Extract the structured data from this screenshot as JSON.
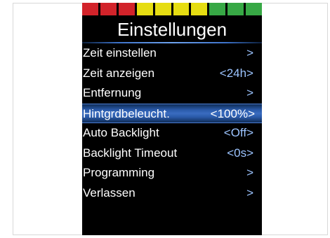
{
  "colors": {
    "bar_red": "#d2232a",
    "bar_yellow": "#e6dd12",
    "bar_green": "#37a845",
    "screen_bg": "#000000",
    "selection": "#3a6cc0",
    "value_text": "#9cc4ff"
  },
  "level_bar": {
    "segments": [
      "red",
      "red",
      "red",
      "yellow",
      "yellow",
      "yellow",
      "yellow",
      "green",
      "green",
      "green"
    ]
  },
  "title": "Einstellungen",
  "menu": {
    "items": [
      {
        "label": "Zeit einstellen",
        "value": ">"
      },
      {
        "label": "Zeit anzeigen",
        "value": "<24h>"
      },
      {
        "label": "Entfernung",
        "value": ">"
      },
      {
        "label": "Hintgrdbeleucht.",
        "value": "<100%>",
        "selected": true
      },
      {
        "label": "Auto Backlight",
        "value": "<Off>"
      },
      {
        "label": "Backlight Timeout",
        "value": "<0s>"
      },
      {
        "label": "Programming",
        "value": ">"
      },
      {
        "label": "Verlassen",
        "value": ">"
      }
    ]
  }
}
